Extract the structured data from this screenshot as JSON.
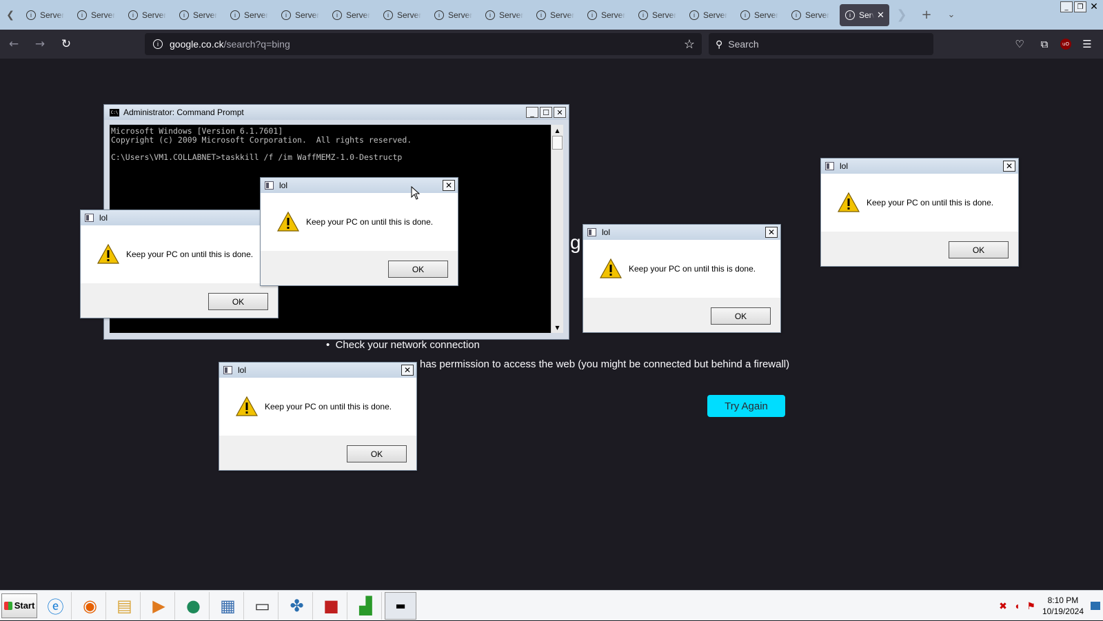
{
  "browser": {
    "tabs": [
      {
        "label": "Server"
      },
      {
        "label": "Server"
      },
      {
        "label": "Server"
      },
      {
        "label": "Server"
      },
      {
        "label": "Server"
      },
      {
        "label": "Server"
      },
      {
        "label": "Server"
      },
      {
        "label": "Server"
      },
      {
        "label": "Server"
      },
      {
        "label": "Server"
      },
      {
        "label": "Server"
      },
      {
        "label": "Server"
      },
      {
        "label": "Server"
      },
      {
        "label": "Server"
      },
      {
        "label": "Server"
      },
      {
        "label": "Server"
      }
    ],
    "active_tab": {
      "label": "Server"
    },
    "url_host": "google.co.ck",
    "url_path": "/search?q=bing",
    "search_placeholder": "Search"
  },
  "page": {
    "partial_letter": "g",
    "bullet_1": "Check your network connection",
    "bullet_2_tail": "has permission to access the web (you might be connected but behind a firewall)",
    "try_again": "Try Again"
  },
  "cmd": {
    "title": "Administrator: Command Prompt",
    "lines": "Microsoft Windows [Version 6.1.7601]\nCopyright (c) 2009 Microsoft Corporation.  All rights reserved.\n\nC:\\Users\\VM1.COLLABNET>taskkill /f /im WaffMEMZ-1.0-Destructp"
  },
  "dialogs": [
    {
      "title": "lol",
      "message": "Keep your PC on until this is done.",
      "ok": "OK"
    },
    {
      "title": "lol",
      "message": "Keep your PC on until this is done.",
      "ok": "OK"
    },
    {
      "title": "lol",
      "message": "Keep your PC on until this is done.",
      "ok": "OK"
    },
    {
      "title": "lol",
      "message": "Keep your PC on until this is done.",
      "ok": "OK"
    },
    {
      "title": "lol",
      "message": "Keep your PC on until this is done.",
      "ok": "OK"
    }
  ],
  "taskbar": {
    "start_label": "Start",
    "time": "8:10 PM",
    "date": "10/19/2024"
  },
  "colors": {
    "page_bg": "#1c1b22",
    "accent_button": "#00ddff",
    "tabbar_bg": "#b7cde2"
  }
}
